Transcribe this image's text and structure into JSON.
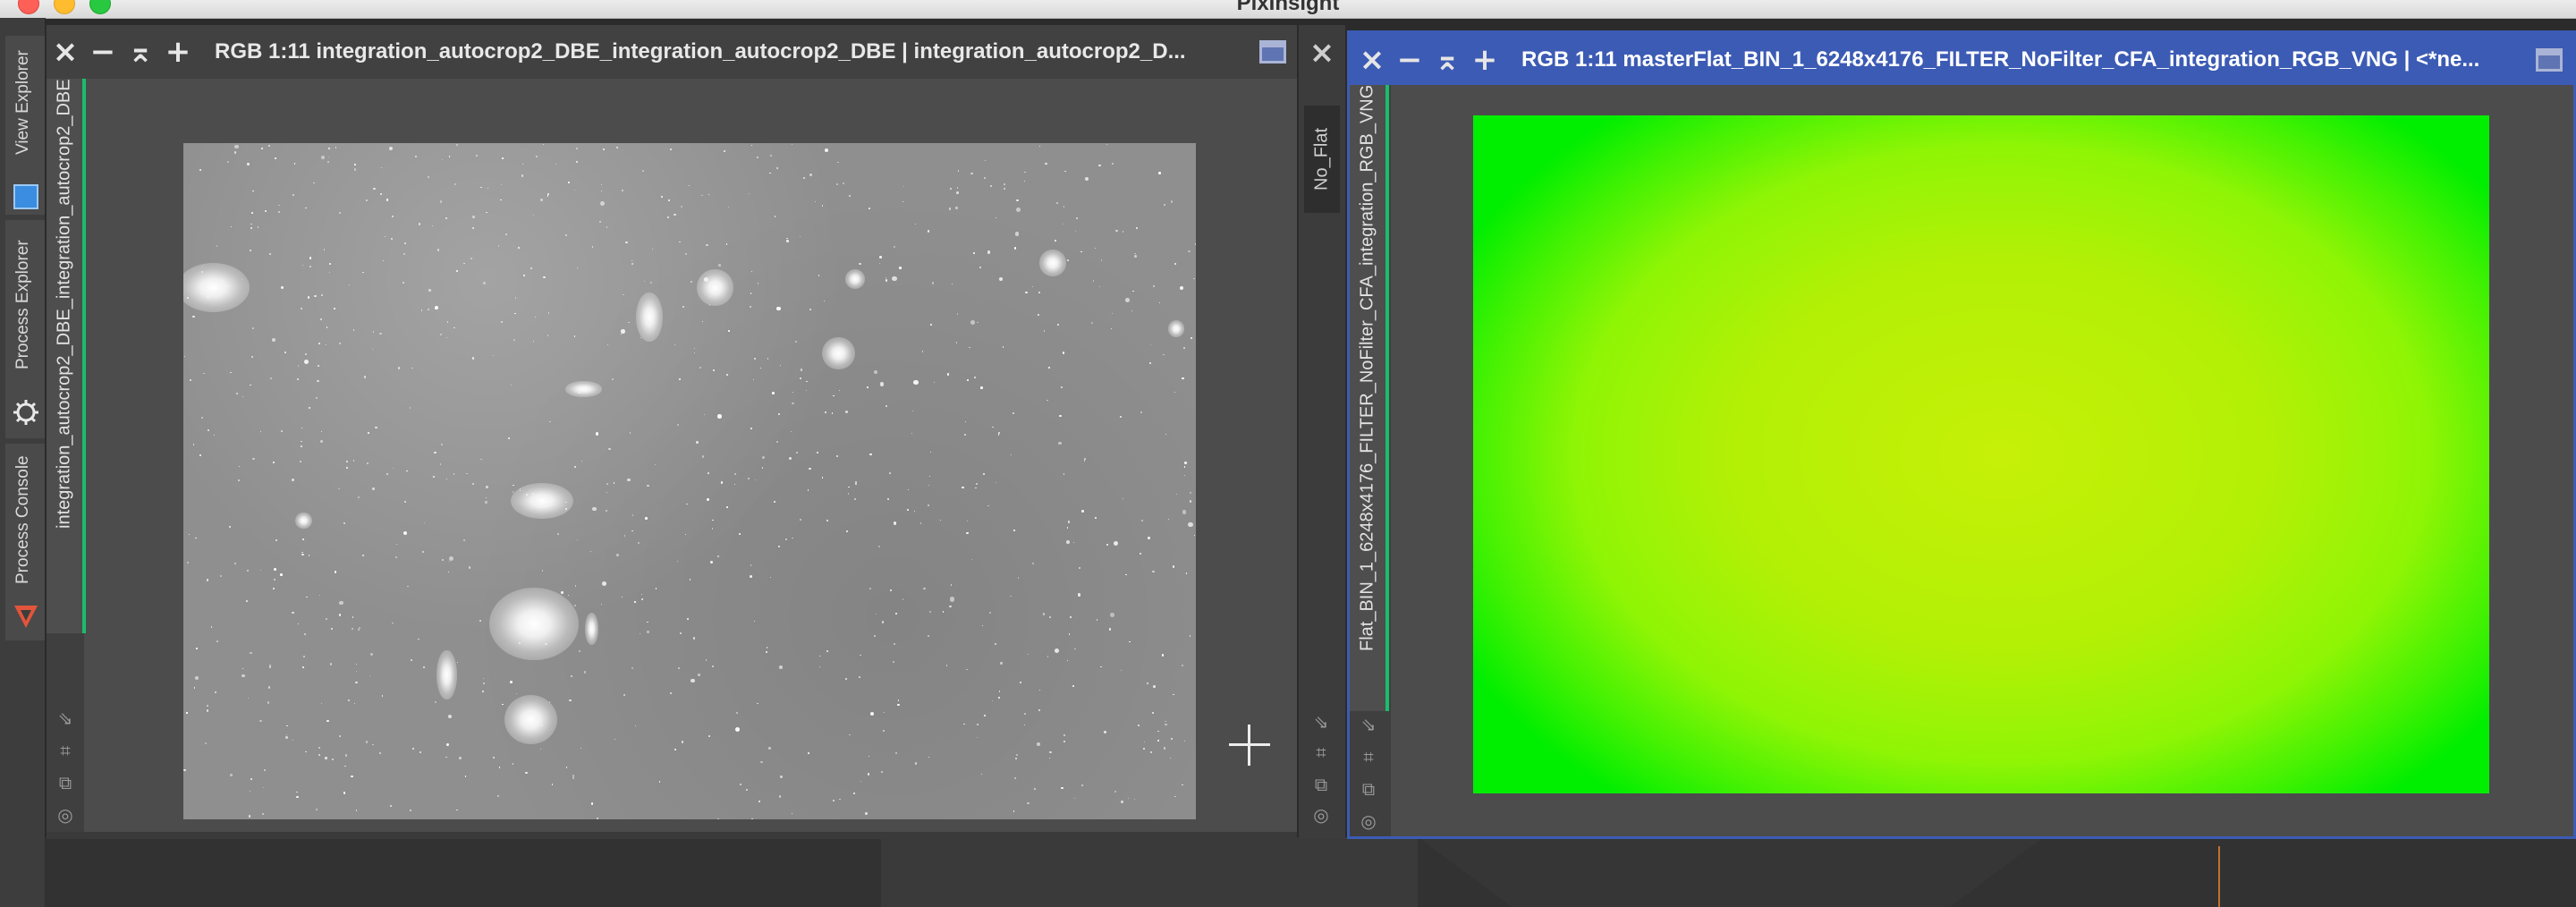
{
  "app": {
    "title": "PixInsight"
  },
  "dock": {
    "tabs": [
      {
        "label": "View Explorer",
        "icon": "view-explorer-icon"
      },
      {
        "label": "Process Explorer",
        "icon": "gear-icon"
      },
      {
        "label": "Process Console",
        "icon": "console-arrow-icon"
      }
    ]
  },
  "windows": {
    "left": {
      "title": "RGB 1:11 integration_autocrop2_DBE_integration_autocrop2_DBE | integration_autocrop2_D...",
      "view_tab_label": "integration_autocrop2_DBE_integration_autocrop2_DBE",
      "controls": [
        "×",
        "−",
        "⌅",
        "+"
      ]
    },
    "right": {
      "title": "RGB 1:11 masterFlat_BIN_1_6248x4176_FILTER_NoFilter_CFA_integration_RGB_VNG | <*ne...",
      "view_tab_label": "Flat_BIN_1_6248x4176_FILTER_NoFilter_CFA_integration_RGB_VNG",
      "extra_tab_label": "No_Flat",
      "controls": [
        "×",
        "−",
        "⌅",
        "+"
      ]
    },
    "middle_close": "×"
  },
  "colors": {
    "active_titlebar": "#3c5bb4",
    "view_tab_accent": "#1bbd6c",
    "flat_center": "#c6f007",
    "flat_edge": "#00ee00"
  }
}
